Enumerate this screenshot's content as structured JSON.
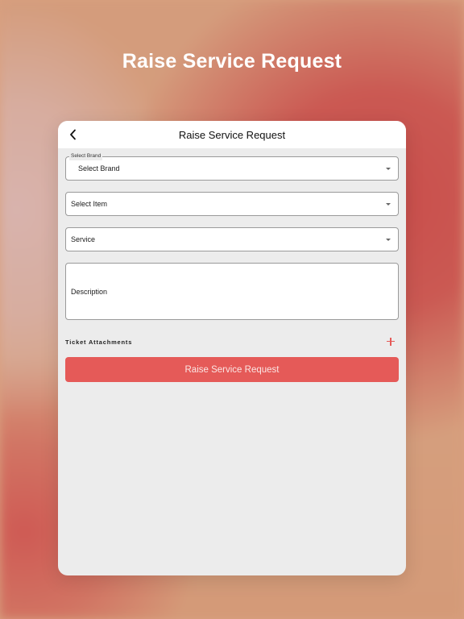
{
  "promo": {
    "headline": "Raise Service Request"
  },
  "navbar": {
    "title": "Raise Service Request",
    "back_icon": "chevron-left-icon"
  },
  "form": {
    "brand": {
      "label": "Select Brand",
      "value": "Select Brand"
    },
    "item": {
      "placeholder": "Select Item"
    },
    "service": {
      "placeholder": "Service"
    },
    "description": {
      "placeholder": "Description"
    },
    "attachments": {
      "label": "Ticket Attachments",
      "add_icon": "plus-icon"
    },
    "submit_label": "Raise Service Request"
  },
  "colors": {
    "accent": "#e55a58",
    "background_red": "#c94d4b",
    "background_peach": "#d6a07f",
    "card": "#ececec"
  }
}
